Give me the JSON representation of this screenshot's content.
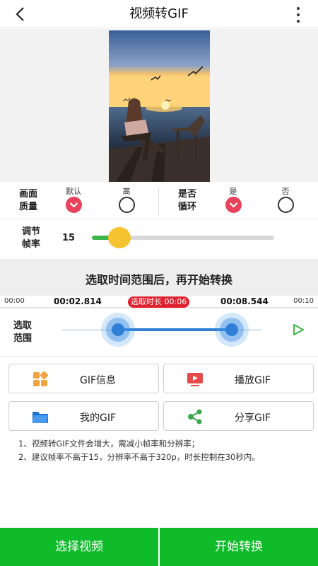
{
  "header": {
    "title": "视频转GIF"
  },
  "quality": {
    "label_line1": "画面",
    "label_line2": "质量",
    "default_label": "默认",
    "high_label": "高",
    "selected": "默认"
  },
  "loop": {
    "label_line1": "是否",
    "label_line2": "循环",
    "yes_label": "是",
    "no_label": "否",
    "selected": "是"
  },
  "fps": {
    "label_line1": "调节",
    "label_line2": "帧率",
    "value": "15",
    "level": 0.15
  },
  "hint": "选取时间范围后，再开始转换",
  "timeline": {
    "start": "00:00",
    "end": "00:10",
    "range_start": "00:02.814",
    "range_end": "00:08.544",
    "duration": "选取时长 00:06"
  },
  "range": {
    "label_line1": "选取",
    "label_line2": "范围",
    "start_fraction": 0.28,
    "end_fraction": 0.85
  },
  "actions": {
    "gif_info": "GIF信息",
    "play_gif": "播放GIF",
    "my_gif": "我的GIF",
    "share_gif": "分享GIF"
  },
  "notes": [
    "1、视频转GIF文件会增大，需减小帧率和分辨率；",
    "2、建议帧率不高于15，分辨率不高于320p，时长控制在30秒内。"
  ],
  "bottom": {
    "select_video": "选择视频",
    "start_convert": "开始转换"
  },
  "colors": {
    "primary_green": "#10bb2a",
    "accent_red": "#e8435b",
    "range_blue": "#2f7fd6",
    "thumb_yellow": "#f6c330"
  },
  "icons": [
    "back-icon",
    "more-icon",
    "grid-icon",
    "video-play-icon",
    "folder-icon",
    "share-icon",
    "play-icon"
  ]
}
